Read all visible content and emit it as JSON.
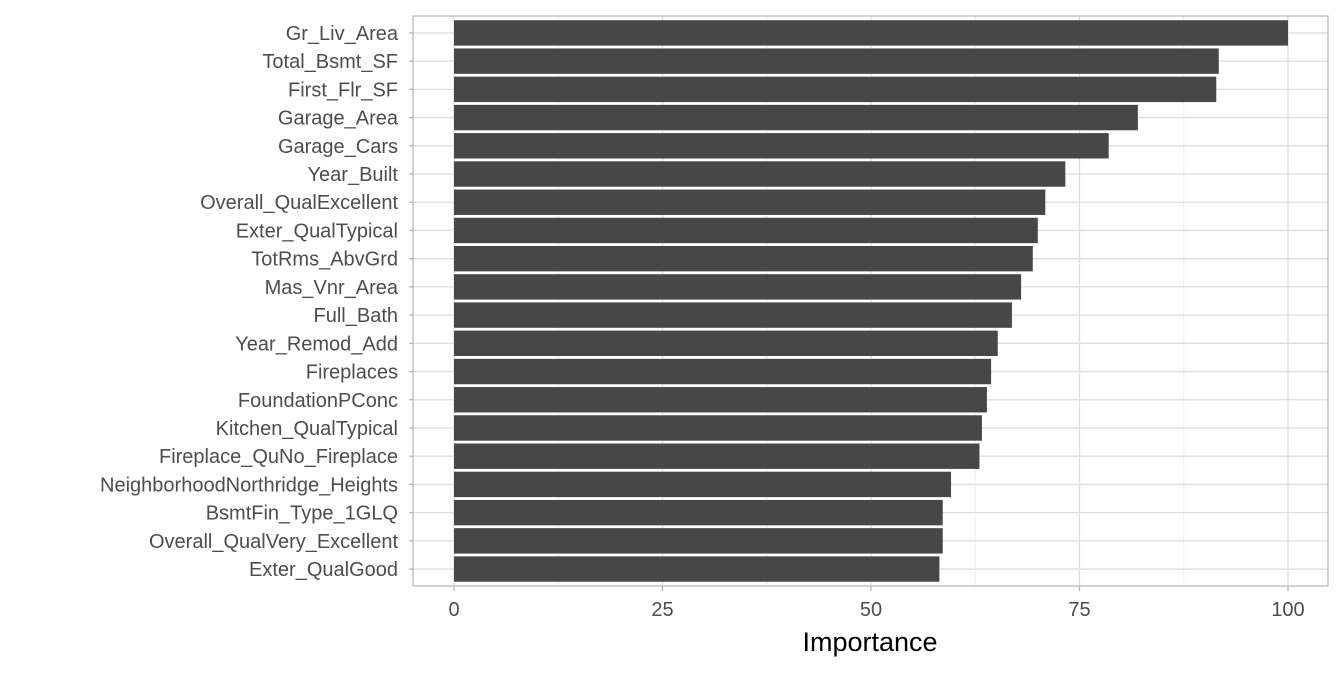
{
  "chart_data": {
    "type": "bar",
    "orientation": "horizontal",
    "title": "",
    "xlabel": "Importance",
    "ylabel": "",
    "xlim": [
      -5,
      105
    ],
    "xticks": [
      0,
      25,
      50,
      75,
      100
    ],
    "xtick_labels": [
      "0",
      "25",
      "50",
      "75",
      "100"
    ],
    "grid": true,
    "bar_color": "#474747",
    "categories": [
      "Gr_Liv_Area",
      "Total_Bsmt_SF",
      "First_Flr_SF",
      "Garage_Area",
      "Garage_Cars",
      "Year_Built",
      "Overall_QualExcellent",
      "Exter_QualTypical",
      "TotRms_AbvGrd",
      "Mas_Vnr_Area",
      "Full_Bath",
      "Year_Remod_Add",
      "Fireplaces",
      "FoundationPConc",
      "Kitchen_QualTypical",
      "Fireplace_QuNo_Fireplace",
      "NeighborhoodNorthridge_Heights",
      "BsmtFin_Type_1GLQ",
      "Overall_QualVery_Excellent",
      "Exter_QualGood"
    ],
    "values": [
      100,
      91.7,
      91.4,
      82.0,
      78.5,
      73.3,
      70.9,
      70.0,
      69.4,
      68.0,
      66.9,
      65.2,
      64.4,
      63.9,
      63.3,
      63.0,
      59.6,
      58.6,
      58.6,
      58.2
    ]
  }
}
